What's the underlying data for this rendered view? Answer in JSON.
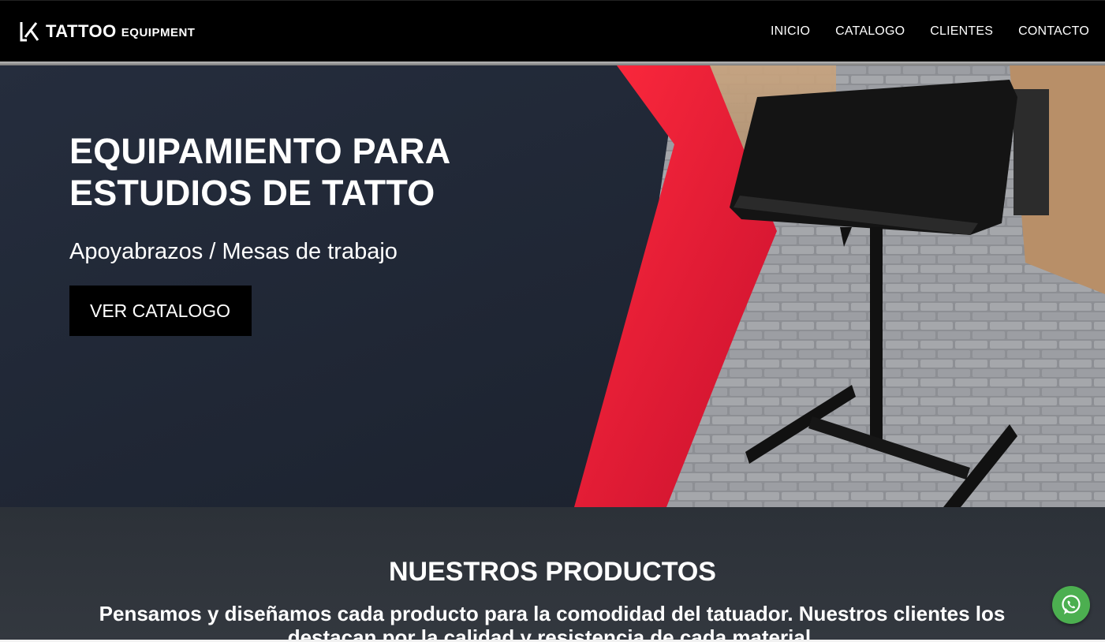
{
  "header": {
    "logo_main": "TATTOO",
    "logo_sub": "EQUIPMENT",
    "nav": [
      {
        "label": "INICIO"
      },
      {
        "label": "CATALOGO"
      },
      {
        "label": "CLIENTES"
      },
      {
        "label": "CONTACTO"
      }
    ]
  },
  "hero": {
    "title_line1": "EQUIPAMIENTO PARA",
    "title_line2": "ESTUDIOS DE TATTO",
    "subtitle": "Apoyabrazos / Mesas de trabajo",
    "button_label": "VER CATALOGO"
  },
  "products": {
    "title": "NUESTROS PRODUCTOS",
    "description": "Pensamos y diseñamos cada producto para la comodidad del tatuador. Nuestros clientes los destacan por la calidad y resistencia de cada material."
  },
  "colors": {
    "header_bg": "#000000",
    "hero_bg": "#1e2533",
    "accent_red": "#e0162b",
    "whatsapp": "#4caf50"
  },
  "icons": {
    "logo": "tattoo-logo-icon",
    "whatsapp": "whatsapp-icon"
  }
}
